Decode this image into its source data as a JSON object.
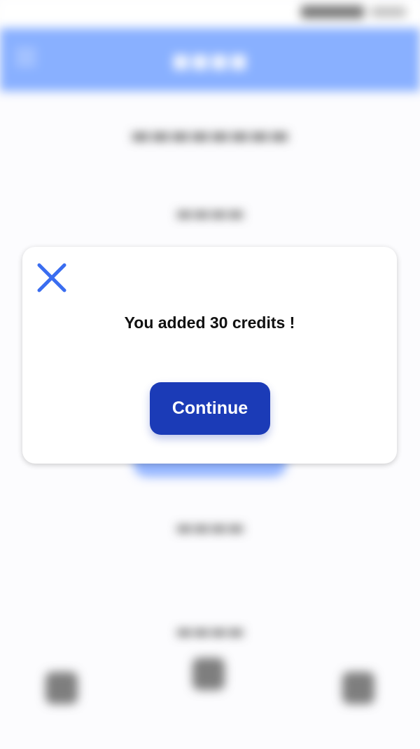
{
  "modal": {
    "message": "You added 30 credits !",
    "continue_label": "Continue"
  },
  "colors": {
    "header_blue": "#4a86ff",
    "button_blue": "#1b3bb7",
    "close_icon_blue": "#3a6df0"
  },
  "icons": {
    "close": "close-icon"
  }
}
